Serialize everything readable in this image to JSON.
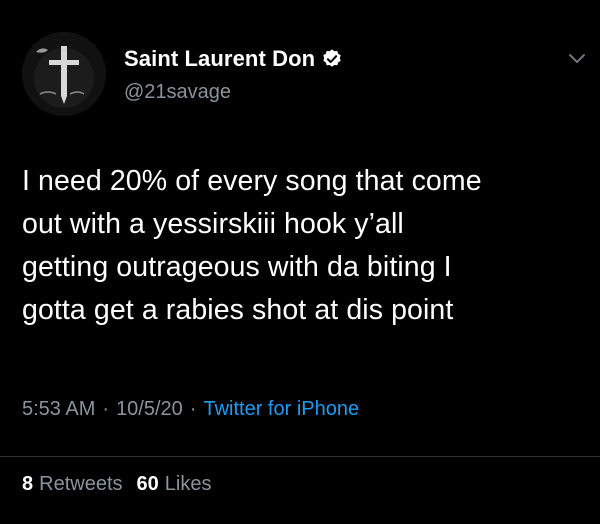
{
  "user": {
    "display_name": "Saint Laurent Don",
    "handle": "@21savage",
    "verified": true
  },
  "tweet": {
    "text": "I need 20% of every song that come\nout with a yessirskiii hook y’all\ngetting outrageous with da biting I\ngotta get a rabies shot at dis point",
    "time": "5:53 AM",
    "date": "10/5/20",
    "separator": "·",
    "source": "Twitter for iPhone"
  },
  "stats": {
    "retweets_count": "8",
    "retweets_label": "Retweets",
    "likes_count": "60",
    "likes_label": "Likes"
  },
  "colors": {
    "background": "#000000",
    "text": "#ffffff",
    "secondary_text": "#8a949c",
    "link": "#1d9bf0",
    "divider": "#2f3336"
  },
  "icons": {
    "verified": "verified-badge-icon",
    "menu": "chevron-down-icon"
  }
}
